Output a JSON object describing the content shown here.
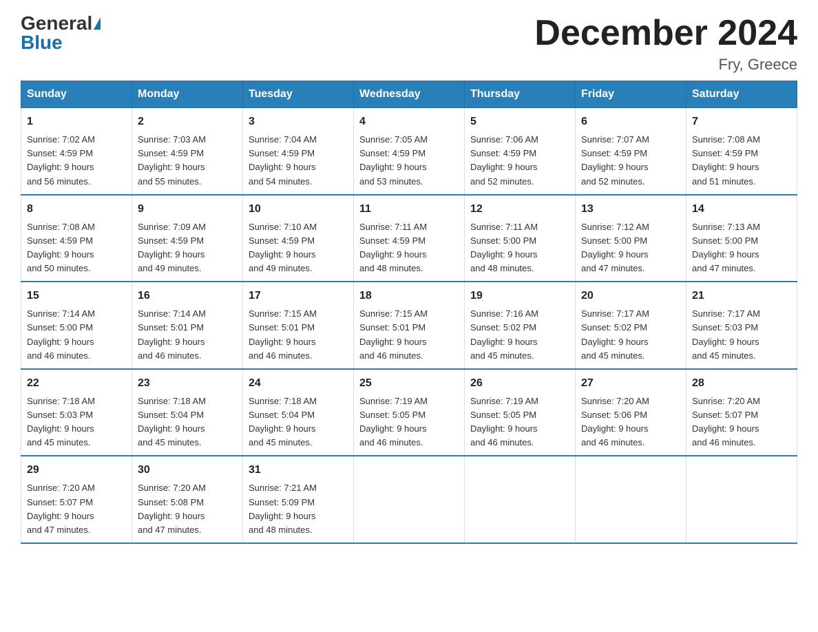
{
  "header": {
    "logo_general": "General",
    "logo_blue": "Blue",
    "month_title": "December 2024",
    "location": "Fry, Greece"
  },
  "weekdays": [
    "Sunday",
    "Monday",
    "Tuesday",
    "Wednesday",
    "Thursday",
    "Friday",
    "Saturday"
  ],
  "weeks": [
    [
      {
        "day": "1",
        "info": "Sunrise: 7:02 AM\nSunset: 4:59 PM\nDaylight: 9 hours\nand 56 minutes."
      },
      {
        "day": "2",
        "info": "Sunrise: 7:03 AM\nSunset: 4:59 PM\nDaylight: 9 hours\nand 55 minutes."
      },
      {
        "day": "3",
        "info": "Sunrise: 7:04 AM\nSunset: 4:59 PM\nDaylight: 9 hours\nand 54 minutes."
      },
      {
        "day": "4",
        "info": "Sunrise: 7:05 AM\nSunset: 4:59 PM\nDaylight: 9 hours\nand 53 minutes."
      },
      {
        "day": "5",
        "info": "Sunrise: 7:06 AM\nSunset: 4:59 PM\nDaylight: 9 hours\nand 52 minutes."
      },
      {
        "day": "6",
        "info": "Sunrise: 7:07 AM\nSunset: 4:59 PM\nDaylight: 9 hours\nand 52 minutes."
      },
      {
        "day": "7",
        "info": "Sunrise: 7:08 AM\nSunset: 4:59 PM\nDaylight: 9 hours\nand 51 minutes."
      }
    ],
    [
      {
        "day": "8",
        "info": "Sunrise: 7:08 AM\nSunset: 4:59 PM\nDaylight: 9 hours\nand 50 minutes."
      },
      {
        "day": "9",
        "info": "Sunrise: 7:09 AM\nSunset: 4:59 PM\nDaylight: 9 hours\nand 49 minutes."
      },
      {
        "day": "10",
        "info": "Sunrise: 7:10 AM\nSunset: 4:59 PM\nDaylight: 9 hours\nand 49 minutes."
      },
      {
        "day": "11",
        "info": "Sunrise: 7:11 AM\nSunset: 4:59 PM\nDaylight: 9 hours\nand 48 minutes."
      },
      {
        "day": "12",
        "info": "Sunrise: 7:11 AM\nSunset: 5:00 PM\nDaylight: 9 hours\nand 48 minutes."
      },
      {
        "day": "13",
        "info": "Sunrise: 7:12 AM\nSunset: 5:00 PM\nDaylight: 9 hours\nand 47 minutes."
      },
      {
        "day": "14",
        "info": "Sunrise: 7:13 AM\nSunset: 5:00 PM\nDaylight: 9 hours\nand 47 minutes."
      }
    ],
    [
      {
        "day": "15",
        "info": "Sunrise: 7:14 AM\nSunset: 5:00 PM\nDaylight: 9 hours\nand 46 minutes."
      },
      {
        "day": "16",
        "info": "Sunrise: 7:14 AM\nSunset: 5:01 PM\nDaylight: 9 hours\nand 46 minutes."
      },
      {
        "day": "17",
        "info": "Sunrise: 7:15 AM\nSunset: 5:01 PM\nDaylight: 9 hours\nand 46 minutes."
      },
      {
        "day": "18",
        "info": "Sunrise: 7:15 AM\nSunset: 5:01 PM\nDaylight: 9 hours\nand 46 minutes."
      },
      {
        "day": "19",
        "info": "Sunrise: 7:16 AM\nSunset: 5:02 PM\nDaylight: 9 hours\nand 45 minutes."
      },
      {
        "day": "20",
        "info": "Sunrise: 7:17 AM\nSunset: 5:02 PM\nDaylight: 9 hours\nand 45 minutes."
      },
      {
        "day": "21",
        "info": "Sunrise: 7:17 AM\nSunset: 5:03 PM\nDaylight: 9 hours\nand 45 minutes."
      }
    ],
    [
      {
        "day": "22",
        "info": "Sunrise: 7:18 AM\nSunset: 5:03 PM\nDaylight: 9 hours\nand 45 minutes."
      },
      {
        "day": "23",
        "info": "Sunrise: 7:18 AM\nSunset: 5:04 PM\nDaylight: 9 hours\nand 45 minutes."
      },
      {
        "day": "24",
        "info": "Sunrise: 7:18 AM\nSunset: 5:04 PM\nDaylight: 9 hours\nand 45 minutes."
      },
      {
        "day": "25",
        "info": "Sunrise: 7:19 AM\nSunset: 5:05 PM\nDaylight: 9 hours\nand 46 minutes."
      },
      {
        "day": "26",
        "info": "Sunrise: 7:19 AM\nSunset: 5:05 PM\nDaylight: 9 hours\nand 46 minutes."
      },
      {
        "day": "27",
        "info": "Sunrise: 7:20 AM\nSunset: 5:06 PM\nDaylight: 9 hours\nand 46 minutes."
      },
      {
        "day": "28",
        "info": "Sunrise: 7:20 AM\nSunset: 5:07 PM\nDaylight: 9 hours\nand 46 minutes."
      }
    ],
    [
      {
        "day": "29",
        "info": "Sunrise: 7:20 AM\nSunset: 5:07 PM\nDaylight: 9 hours\nand 47 minutes."
      },
      {
        "day": "30",
        "info": "Sunrise: 7:20 AM\nSunset: 5:08 PM\nDaylight: 9 hours\nand 47 minutes."
      },
      {
        "day": "31",
        "info": "Sunrise: 7:21 AM\nSunset: 5:09 PM\nDaylight: 9 hours\nand 48 minutes."
      },
      {
        "day": "",
        "info": ""
      },
      {
        "day": "",
        "info": ""
      },
      {
        "day": "",
        "info": ""
      },
      {
        "day": "",
        "info": ""
      }
    ]
  ]
}
